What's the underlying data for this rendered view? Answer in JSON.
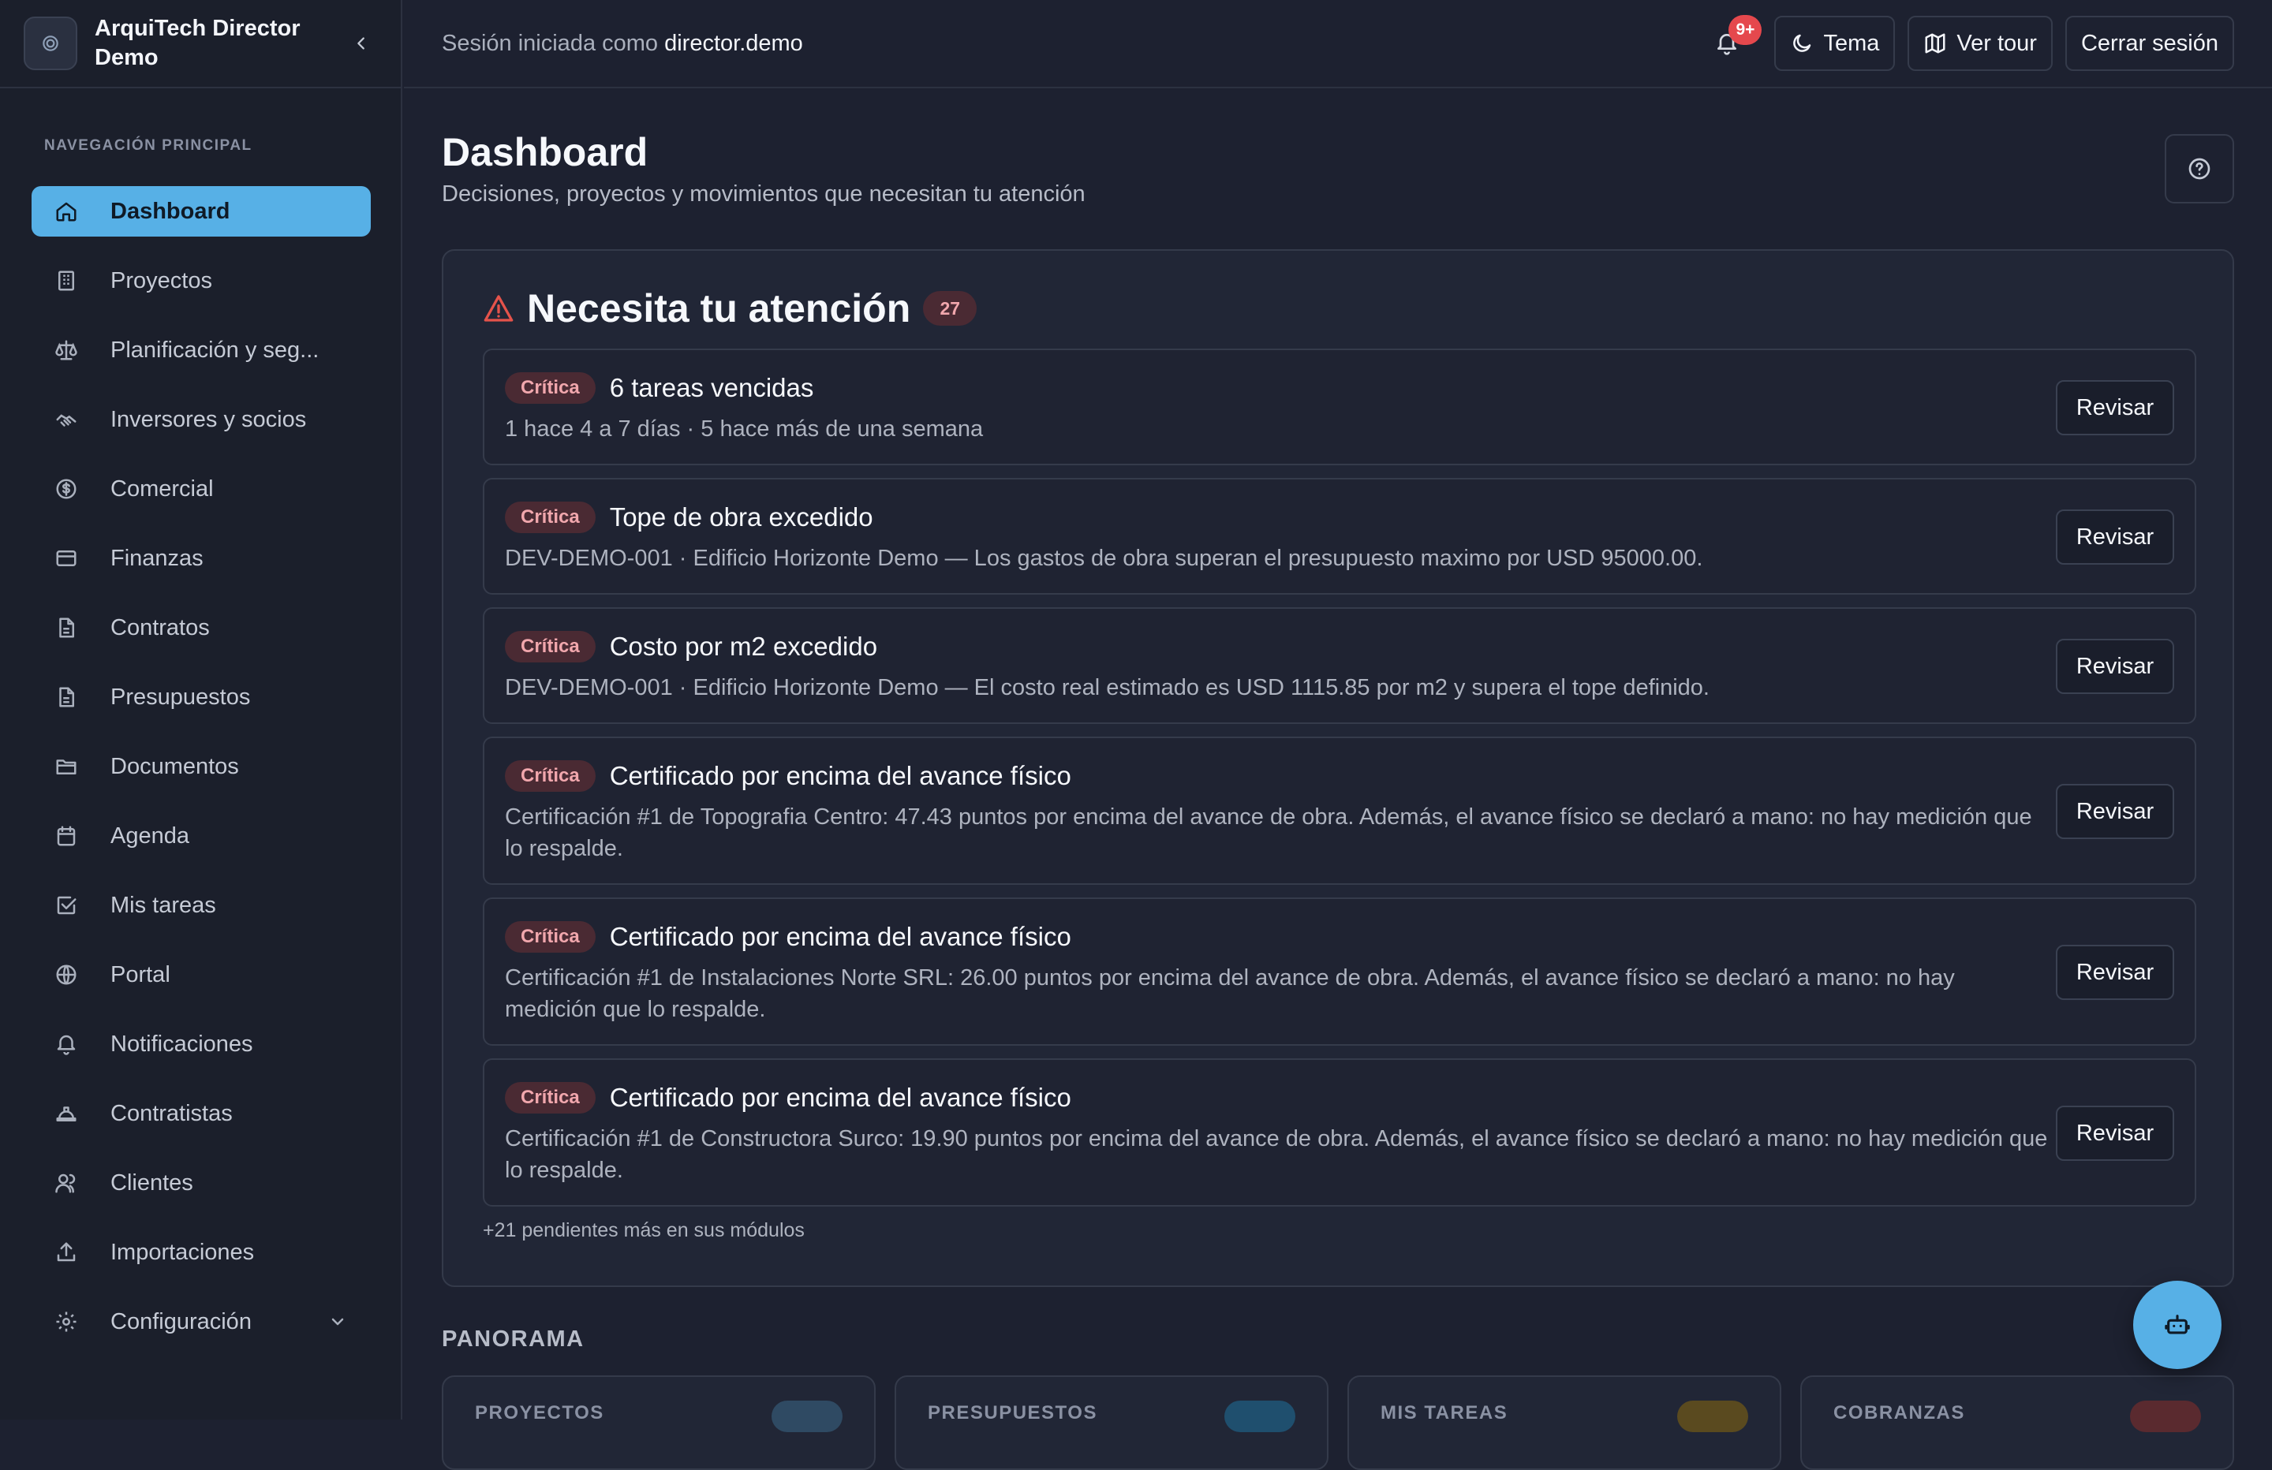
{
  "brand": {
    "name": "ArquiTech Director Demo"
  },
  "sidebar": {
    "section_title": "NAVEGACIÓN PRINCIPAL",
    "items": [
      {
        "label": "Dashboard",
        "icon": "home-icon",
        "active": true
      },
      {
        "label": "Proyectos",
        "icon": "building-icon"
      },
      {
        "label": "Planificación y seg...",
        "icon": "scale-icon"
      },
      {
        "label": "Inversores y socios",
        "icon": "handshake-icon"
      },
      {
        "label": "Comercial",
        "icon": "dollar-circle-icon"
      },
      {
        "label": "Finanzas",
        "icon": "credit-card-icon"
      },
      {
        "label": "Contratos",
        "icon": "document-icon"
      },
      {
        "label": "Presupuestos",
        "icon": "document-icon"
      },
      {
        "label": "Documentos",
        "icon": "folder-icon"
      },
      {
        "label": "Agenda",
        "icon": "calendar-icon"
      },
      {
        "label": "Mis tareas",
        "icon": "checkbox-icon"
      },
      {
        "label": "Portal",
        "icon": "globe-icon"
      },
      {
        "label": "Notificaciones",
        "icon": "bell-icon"
      },
      {
        "label": "Contratistas",
        "icon": "hard-hat-icon"
      },
      {
        "label": "Clientes",
        "icon": "users-icon"
      },
      {
        "label": "Importaciones",
        "icon": "upload-icon"
      },
      {
        "label": "Configuración",
        "icon": "gear-icon"
      }
    ]
  },
  "topbar": {
    "session_prefix": "Sesión iniciada como",
    "session_user": "director.demo",
    "notifications_count": "9+",
    "theme_label": "Tema",
    "tour_label": "Ver tour",
    "logout_label": "Cerrar sesión"
  },
  "page": {
    "title": "Dashboard",
    "subtitle": "Decisiones, proyectos y movimientos que necesitan tu atención"
  },
  "attention": {
    "title": "Necesita tu atención",
    "count": "27",
    "action_label": "Revisar",
    "items": [
      {
        "severity": "Crítica",
        "title": "6 tareas vencidas",
        "description": "1 hace 4 a 7 días · 5 hace más de una semana"
      },
      {
        "severity": "Crítica",
        "title": "Tope de obra excedido",
        "description": "DEV-DEMO-001 · Edificio Horizonte Demo — Los gastos de obra superan el presupuesto maximo por USD 95000.00."
      },
      {
        "severity": "Crítica",
        "title": "Costo por m2 excedido",
        "description": "DEV-DEMO-001 · Edificio Horizonte Demo — El costo real estimado es USD 1115.85 por m2 y supera el tope definido."
      },
      {
        "severity": "Crítica",
        "title": "Certificado por encima del avance físico",
        "description": "Certificación #1 de Topografia Centro: 47.43 puntos por encima del avance de obra. Además, el avance físico se declaró a mano: no hay medición que lo respalde."
      },
      {
        "severity": "Crítica",
        "title": "Certificado por encima del avance físico",
        "description": "Certificación #1 de Instalaciones Norte SRL: 26.00 puntos por encima del avance de obra. Además, el avance físico se declaró a mano: no hay medición que lo respalde."
      },
      {
        "severity": "Crítica",
        "title": "Certificado por encima del avance físico",
        "description": "Certificación #1 de Constructora Surco: 19.90 puntos por encima del avance de obra. Además, el avance físico se declaró a mano: no hay medición que lo respalde."
      }
    ],
    "more_pending": "+21 pendientes más en sus módulos"
  },
  "panorama": {
    "title": "PANORAMA",
    "cards": [
      {
        "label": "PROYECTOS",
        "chip_color": "#2f4a63"
      },
      {
        "label": "PRESUPUESTOS",
        "chip_color": "#1f4f6e"
      },
      {
        "label": "MIS TAREAS",
        "chip_color": "#5a4a1f"
      },
      {
        "label": "COBRANZAS",
        "chip_color": "#5a2a2f"
      }
    ]
  },
  "colors": {
    "accent": "#57b0e6",
    "critical_bg": "#4a2a33",
    "critical_text": "#f1a7ad",
    "warning": "#e5534b",
    "background": "#1d2130"
  }
}
